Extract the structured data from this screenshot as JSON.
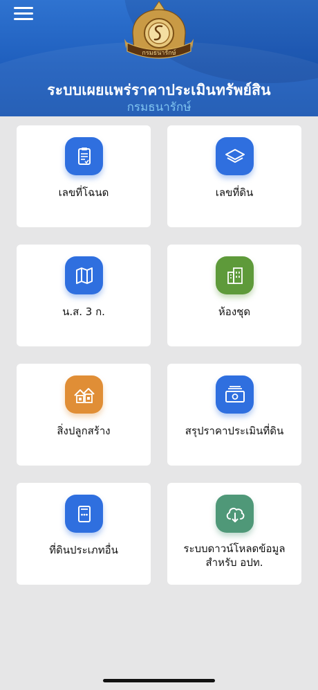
{
  "header": {
    "title": "ระบบเผยแพร่ราคาประเมินทรัพย์สิน",
    "subtitle": "กรมธนารักษ์",
    "logo_text": "กรมธนารักษ์"
  },
  "colors": {
    "header_blue": "#1f5fbe",
    "icon_blue": "#2f6fdf",
    "icon_green": "#5e9a3a",
    "icon_orange": "#e08e36",
    "icon_teal": "#4f9878",
    "background": "#e6e6e7"
  },
  "menu": [
    {
      "label": "เลขที่โฉนด",
      "icon": "document-list-icon"
    },
    {
      "label": "เลขที่ดิน",
      "icon": "layers-icon"
    },
    {
      "label": "น.ส. 3 ก.",
      "icon": "map-icon"
    },
    {
      "label": "ห้องชุด",
      "icon": "buildings-icon"
    },
    {
      "label": "สิ่งปลูกสร้าง",
      "icon": "houses-icon"
    },
    {
      "label": "สรุปราคาประเมินที่ดิน",
      "icon": "money-icon"
    },
    {
      "label": "ที่ดินประเภทอื่น",
      "icon": "form-icon"
    },
    {
      "label_line1": "ระบบดาวน์โหลดข้อมูล",
      "label_line2": "สำหรับ อปท.",
      "icon": "cloud-download-icon"
    }
  ]
}
